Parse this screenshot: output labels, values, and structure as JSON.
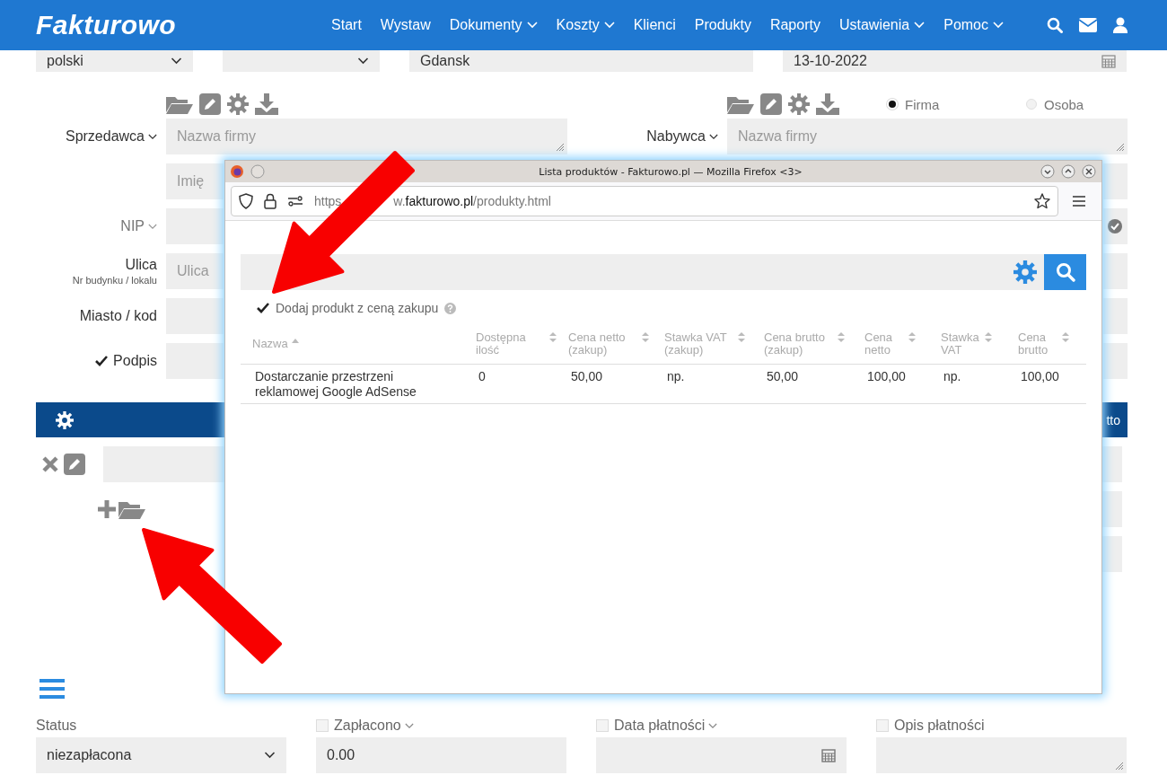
{
  "header": {
    "logo": "Fakturowo",
    "nav": [
      {
        "label": "Start",
        "dropdown": false
      },
      {
        "label": "Wystaw",
        "dropdown": false
      },
      {
        "label": "Dokumenty",
        "dropdown": true
      },
      {
        "label": "Koszty",
        "dropdown": true
      },
      {
        "label": "Klienci",
        "dropdown": false
      },
      {
        "label": "Produkty",
        "dropdown": false
      },
      {
        "label": "Raporty",
        "dropdown": false
      },
      {
        "label": "Ustawienia",
        "dropdown": true
      },
      {
        "label": "Pomoc",
        "dropdown": true
      }
    ]
  },
  "top_row": {
    "language": "polski",
    "city": "Gdansk",
    "date": "13-10-2022"
  },
  "seller": {
    "label": "Sprzedawca",
    "name_placeholder": "Nazwa firmy",
    "first_name_placeholder": "Imię",
    "nip_label": "NIP",
    "street_label": "Ulica",
    "street_sublabel": "Nr budynku / lokalu",
    "street_placeholder": "Ulica",
    "city_label": "Miasto / kod",
    "signature": {
      "label": "Podpis",
      "checked": true
    }
  },
  "buyer": {
    "label": "Nabywca",
    "name_placeholder": "Nazwa firmy",
    "types": [
      {
        "label": "Firma",
        "selected": true
      },
      {
        "label": "Osoba",
        "selected": false
      }
    ]
  },
  "items_bar": {
    "column_end": "tto"
  },
  "payment": {
    "status_label": "Status",
    "status": "niezapłacona",
    "paid": {
      "label": "Zapłacono",
      "checked": false,
      "value": "0.00"
    },
    "due": {
      "label": "Data płatności",
      "checked": false
    },
    "note": {
      "label": "Opis płatności",
      "checked": false
    }
  },
  "popup": {
    "title": "Lista produktów - Fakturowo.pl — Mozilla Firefox <3>",
    "url_start": "https",
    "url_end": "w.**fakturowo.pl**/produkty.html",
    "purchase_price": {
      "label": "Dodaj produkt z ceną zakupu",
      "checked": true
    },
    "table": {
      "columns": [
        {
          "label": "Nazwa",
          "sorted": true
        },
        {
          "label": "Dostępna ilość",
          "sorted": false
        },
        {
          "label": "Cena netto (zakup)",
          "sorted": false
        },
        {
          "label": "Stawka VAT (zakup)",
          "sorted": false
        },
        {
          "label": "Cena brutto (zakup)",
          "sorted": false
        },
        {
          "label": "Cena netto",
          "sorted": false
        },
        {
          "label": "Stawka VAT",
          "sorted": false
        },
        {
          "label": "Cena brutto",
          "sorted": false
        }
      ],
      "rows": [
        [
          "Dostarczanie przestrzeni reklamowej Google AdSense",
          "0",
          "50,00",
          "np.",
          "50,00",
          "100,00",
          "np.",
          "100,00"
        ]
      ]
    }
  }
}
